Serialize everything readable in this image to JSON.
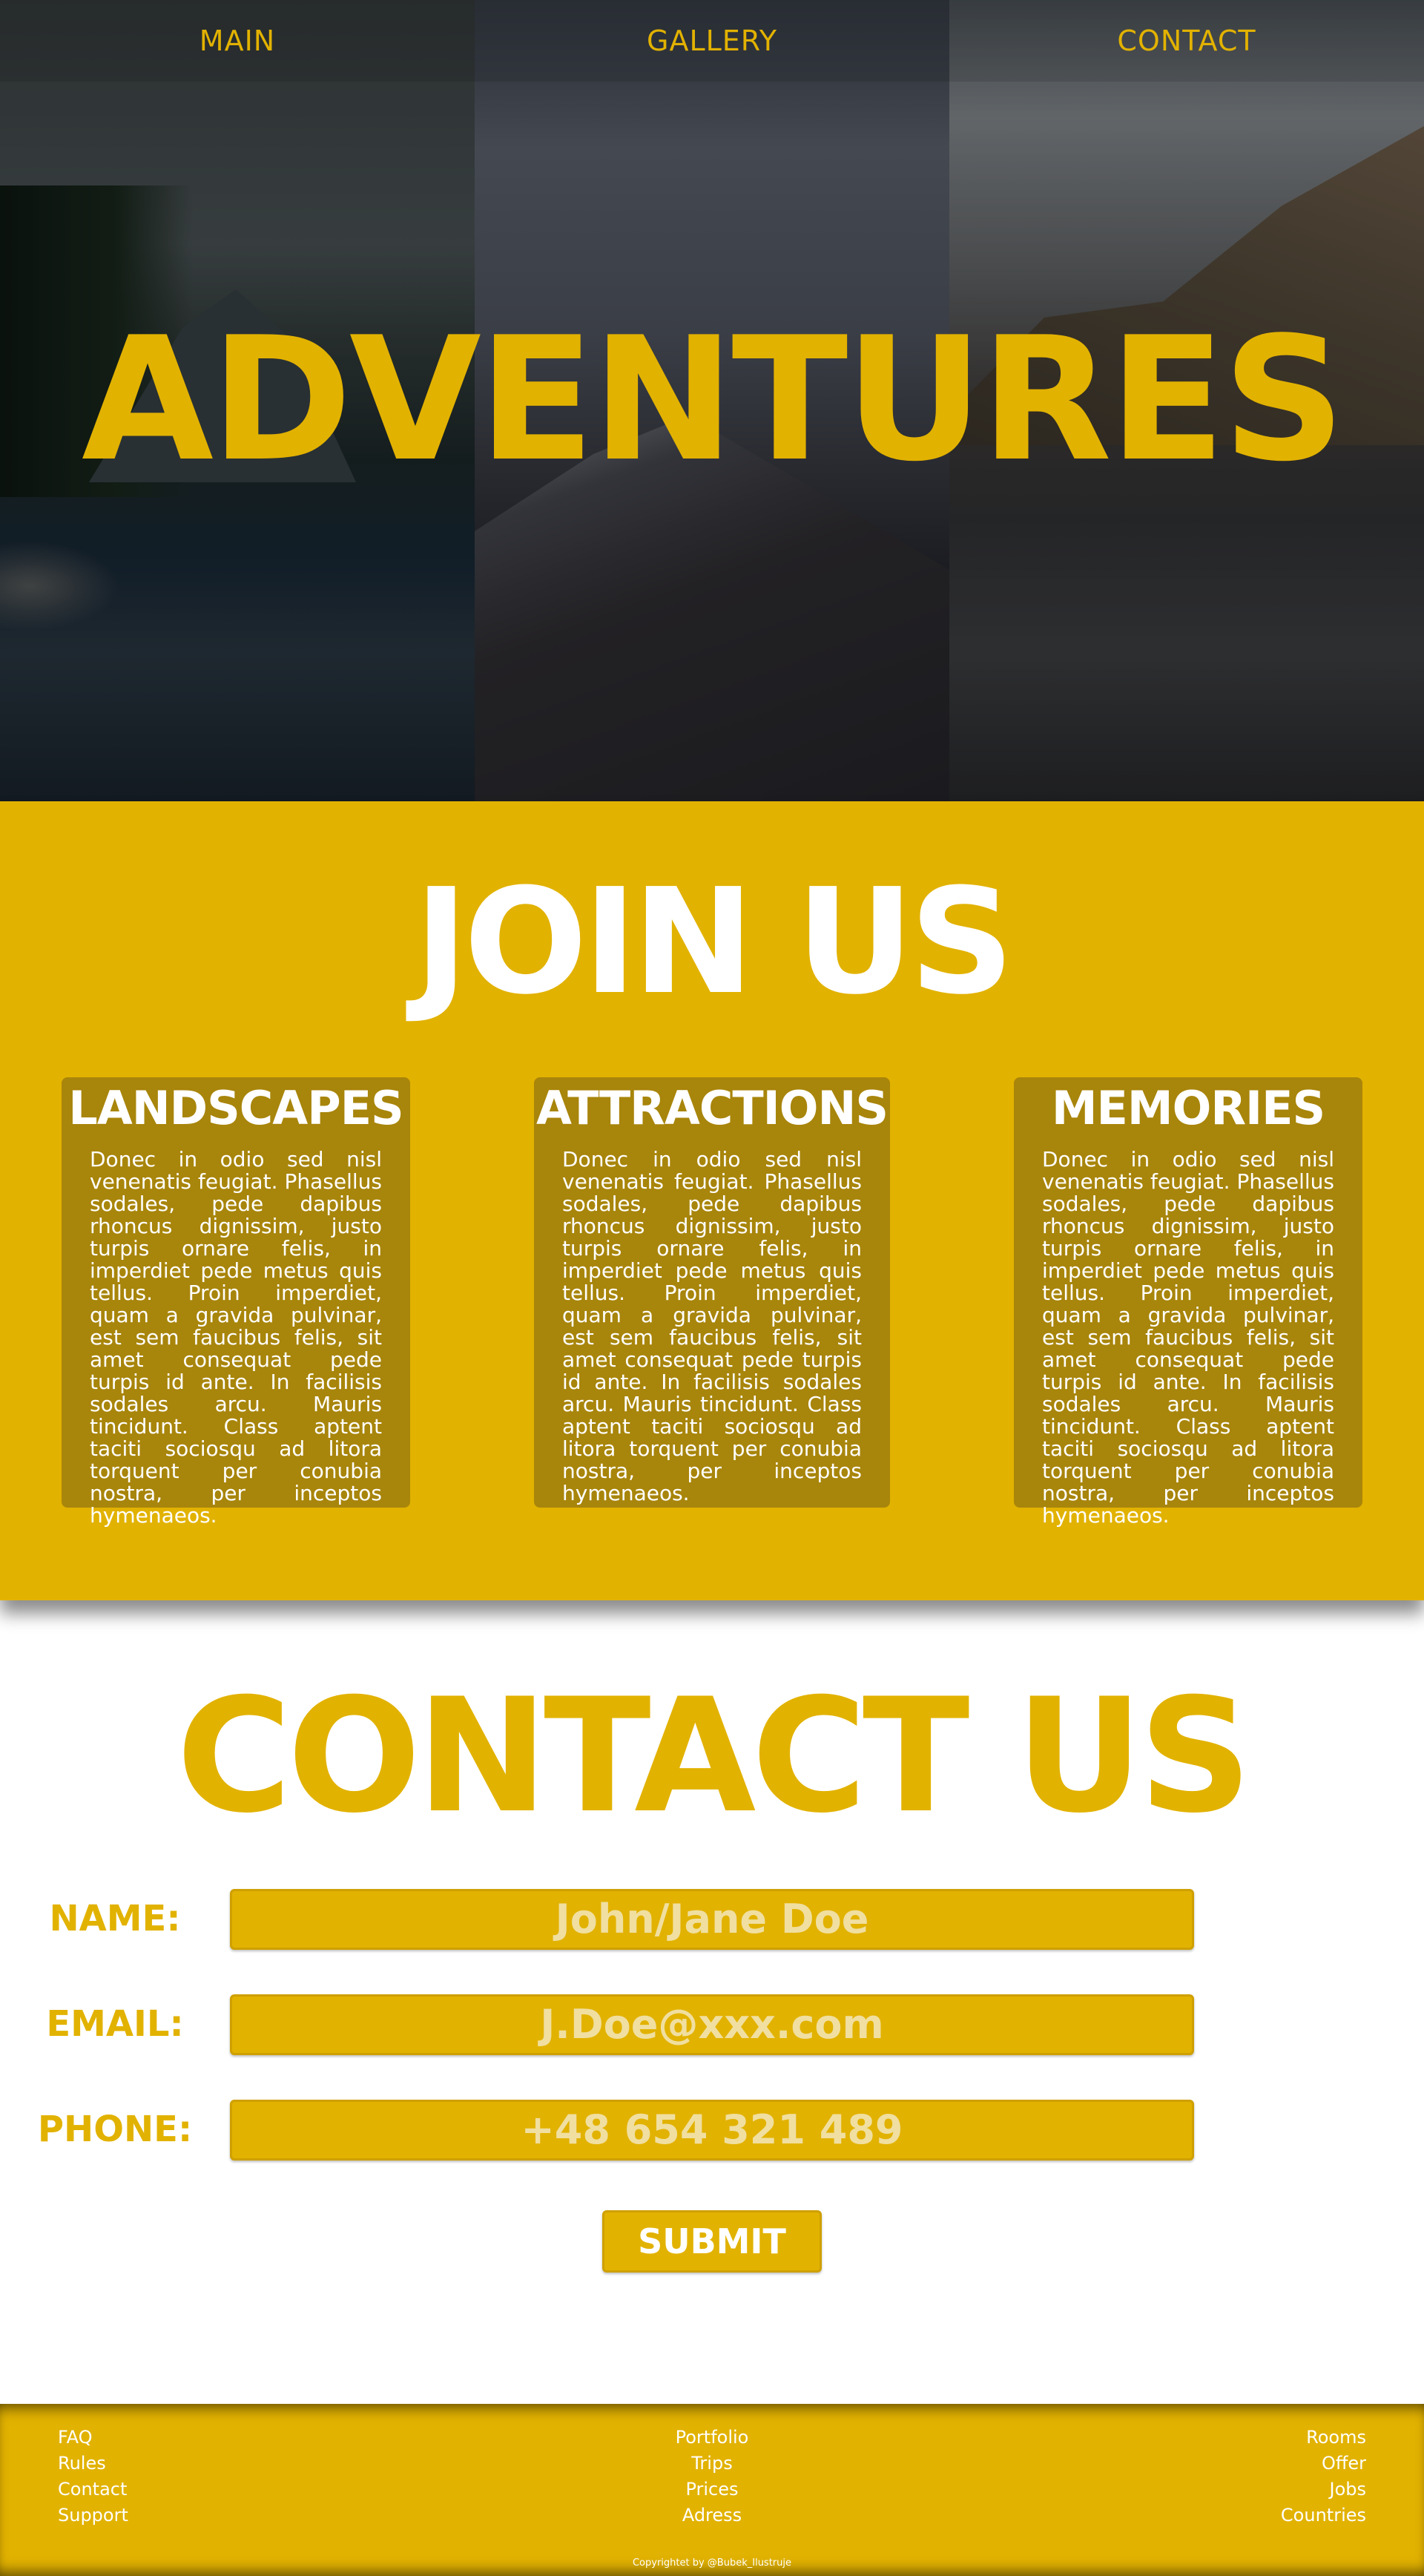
{
  "nav": {
    "items": [
      "MAIN",
      "GALLERY",
      "CONTACT"
    ]
  },
  "hero": {
    "title": "ADVENTURES"
  },
  "join": {
    "title": "JOIN US",
    "cards": [
      {
        "title": "LANDSCAPES",
        "text": "Donec in odio sed nisl venenatis feugiat. Phasellus sodales, pede dapibus rhoncus dignissim, justo turpis ornare felis, in imperdiet pede metus quis tellus. Proin imperdiet, quam a gravida pulvinar, est sem faucibus felis, sit amet consequat pede turpis id ante. In facilisis sodales arcu. Mauris tincidunt. Class aptent taciti sociosqu ad litora torquent per conubia nostra, per inceptos hymenaeos."
      },
      {
        "title": "ATTRACTIONS",
        "text": "Donec in odio sed nisl venenatis feugiat. Phasellus sodales, pede dapibus rhoncus dignissim, justo turpis ornare felis, in imperdiet pede metus quis tellus. Proin imperdiet, quam a gravida pulvinar, est sem faucibus felis, sit amet consequat pede turpis id ante. In facilisis sodales arcu. Mauris tincidunt. Class aptent taciti sociosqu ad litora torquent per conubia nostra, per inceptos hymenaeos."
      },
      {
        "title": "MEMORIES",
        "text": "Donec in odio sed nisl venenatis feugiat. Phasellus sodales, pede dapibus rhoncus dignissim, justo turpis ornare felis, in imperdiet pede metus quis tellus. Proin imperdiet, quam a gravida pulvinar, est sem faucibus felis, sit amet consequat pede turpis id ante. In facilisis sodales arcu. Mauris tincidunt. Class aptent taciti sociosqu ad litora torquent per conubia nostra, per inceptos hymenaeos."
      }
    ]
  },
  "contact": {
    "title": "CONTACT US",
    "fields": [
      {
        "label": "NAME:",
        "placeholder": "John/Jane Doe"
      },
      {
        "label": "EMAIL:",
        "placeholder": "J.Doe@xxx.com"
      },
      {
        "label": "PHONE:",
        "placeholder": "+48 654 321 489"
      }
    ],
    "submit_label": "SUBMIT"
  },
  "footer": {
    "col1": [
      "FAQ",
      "Rules",
      "Contact",
      "Support"
    ],
    "col2": [
      "Portfolio",
      "Trips",
      "Prices",
      "Adress"
    ],
    "col3": [
      "Rooms",
      "Offer",
      "Jobs",
      "Countries"
    ],
    "copyright": "Copyrightet by @Bubek_Ilustruje"
  },
  "colors": {
    "accent": "#e2b200",
    "card": "#a8850b",
    "background": "#ffffff"
  }
}
